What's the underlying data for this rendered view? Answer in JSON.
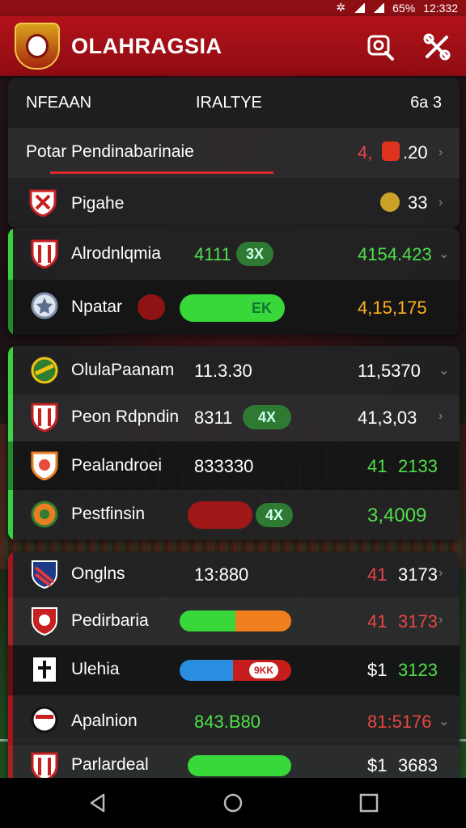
{
  "status_bar": {
    "icons": [
      "notification-icon",
      "wifi-icon",
      "signal-icon"
    ],
    "battery": "65%",
    "time": "12:332"
  },
  "app": {
    "title": "OLAHRAGSIA",
    "actions": [
      "search-icon",
      "tools-icon"
    ]
  },
  "header": {
    "col1": "NFEAAN",
    "col2": "IRALTYE",
    "col3": "6a 3"
  },
  "featured": [
    {
      "name": "Potar Pendinabarinaie",
      "value": "4, ",
      "value2": ".20"
    },
    {
      "name": "Pigahe",
      "value": "33"
    }
  ],
  "group1": [
    {
      "team": "Alrodnlqmia",
      "score": "4111",
      "badge": "3X",
      "odds": "4154.423"
    },
    {
      "team": "Npatar",
      "badge": "EK",
      "odds": "4,15,175"
    }
  ],
  "group2": [
    {
      "team": "OlulaPaanam",
      "score": "11.3.30",
      "odds": "11,5370"
    },
    {
      "team": "Peon Rdpndin",
      "score": "8311",
      "badge": "4X",
      "odds": "41,3,03"
    },
    {
      "team": "Pealandroei",
      "score": "833330",
      "odds_a": "41",
      "odds_b": "2133"
    },
    {
      "team": "Pestfinsin",
      "badge": "4X",
      "odds": "3,4009"
    }
  ],
  "group3": [
    {
      "team": "Onglns",
      "score": "13:880",
      "odds_a": "41",
      "odds_b": "3173"
    },
    {
      "team": "Pedirbaria",
      "odds_a": "41",
      "odds_b": "3173"
    },
    {
      "team": "Ulehia",
      "bar_label": "9KK",
      "odds_a": "$1",
      "odds_b": "3123"
    },
    {
      "team": "Apalnion",
      "score": "843.B80",
      "odds": "81:5176"
    },
    {
      "team": "Parlardeal",
      "odds_a": "$1",
      "odds_b": "3683"
    }
  ],
  "colors": {
    "brand": "#b3121a",
    "win": "#4ee04a",
    "loss": "#e94545",
    "card": "#222224"
  }
}
